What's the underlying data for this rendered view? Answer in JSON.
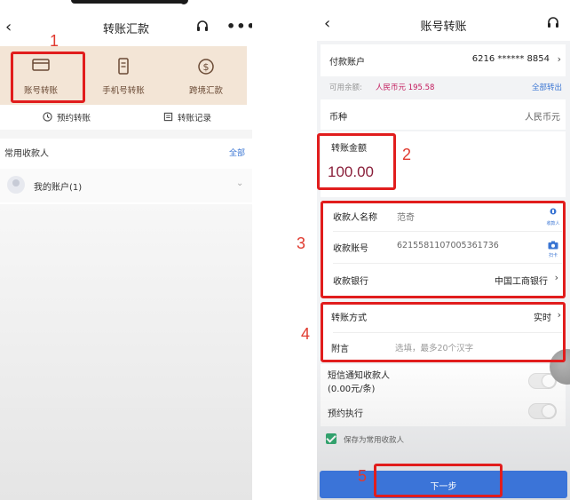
{
  "left": {
    "title": "转账汇款",
    "quick_actions": [
      {
        "label": "账号转账",
        "icon": "card-icon"
      },
      {
        "label": "手机号转账",
        "icon": "phone-icon"
      },
      {
        "label": "跨境汇款",
        "icon": "dollar-icon"
      }
    ],
    "sub_actions": [
      {
        "label": "预约转账",
        "icon": "clock-icon"
      },
      {
        "label": "转账记录",
        "icon": "record-icon"
      }
    ],
    "frequent_title": "常用收款人",
    "frequent_all": "全部",
    "my_account": "我的账户(1)"
  },
  "right": {
    "title": "账号转账",
    "payer_label": "付款账户",
    "payer_value": "6216 ****** 8854",
    "balance_label": "可用余额:",
    "balance_value": "人民币元 195.58",
    "balance_link": "全部转出",
    "currency_label": "币种",
    "currency_value": "人民币元",
    "amount_label": "转账金额",
    "amount_value": "100.00",
    "payee_name_label": "收款人名称",
    "payee_name_value": "范奇",
    "payee_icon_label": "收款人",
    "payee_account_label": "收款账号",
    "payee_account_value": "6215581107005361736",
    "scan_icon_label": "扫卡",
    "bank_label": "收款银行",
    "bank_value": "中国工商银行",
    "method_label": "转账方式",
    "method_value": "实时",
    "note_label": "附言",
    "note_placeholder": "选填，最多20个汉字",
    "sms_label": "短信通知收款人",
    "sms_fee": "(0.00元/条)",
    "schedule_label": "预约执行",
    "save_label": "保存为常用收款人",
    "next_label": "下一步"
  },
  "annotations": [
    "1",
    "2",
    "3",
    "4",
    "5"
  ],
  "colors": {
    "accent_blue": "#3b74d8",
    "highlight_red": "#e11d1d",
    "amount": "#8a1f3a",
    "card_bar": "#f3e5d6",
    "check_green": "#21a366"
  }
}
